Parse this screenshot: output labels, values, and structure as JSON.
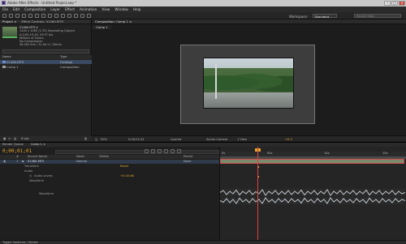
{
  "window": {
    "title": "Adobe After Effects - Untitled Project.aep *",
    "buttons": [
      "–",
      "□",
      "×"
    ]
  },
  "menu": [
    "File",
    "Edit",
    "Composition",
    "Layer",
    "Effect",
    "Animation",
    "View",
    "Window",
    "Help"
  ],
  "toolbar": {
    "workspace_label": "Workspace:",
    "workspace_value": "Standard",
    "search_placeholder": "Search Help"
  },
  "project_panel": {
    "tabs": [
      "Project ×",
      "Effect Controls: 01460.MTS"
    ],
    "file_name": "01460.MTS ▾",
    "info_lines": [
      "1440 x 1080 (1.33) Separating (Upper)",
      "Δ 0;00;15;16, 29.97 fps",
      "Millions of Colors",
      "No Compression",
      "48.000 kHz / 32 bit U / Stereo"
    ],
    "columns": [
      "Name",
      "Type"
    ],
    "rows": [
      {
        "name": "01460.MTS",
        "type": "Footage",
        "selected": true
      },
      {
        "name": "Comp 1",
        "type": "Composition",
        "selected": false
      }
    ],
    "footer_bpc": "8 bpc"
  },
  "comp_panel": {
    "tab": "Composition: Comp 1 ×",
    "subtab": "Comp 1",
    "viewer_controls": {
      "zoom": "50%",
      "time": "0;00;01;01",
      "quality": "Quarter",
      "camera": "Active Camera",
      "views": "1 View",
      "exposure": "+0.0"
    }
  },
  "timeline": {
    "tabs": [
      "Render Queue",
      "Comp 1 ×"
    ],
    "timecode": "0;00;01;01",
    "column_headers": [
      "#",
      "Source Name",
      "Mode",
      "TrkMat",
      "Parent"
    ],
    "layers": [
      {
        "num": "1",
        "name": "01460.MTS",
        "mode": "Normal",
        "parent": "None"
      }
    ],
    "sub_rows": [
      {
        "label": "Transform",
        "value": "Reset"
      },
      {
        "label": "Audio",
        "value": ""
      },
      {
        "label": "Audio Levels",
        "value": "+0.00 dB"
      },
      {
        "label": "Waveform",
        "value": ""
      },
      {
        "label": "Waveform",
        "value": ""
      }
    ],
    "ruler": [
      "0s",
      "05s",
      "10s",
      "15s"
    ],
    "footer": "Toggle Switches / Modes"
  }
}
